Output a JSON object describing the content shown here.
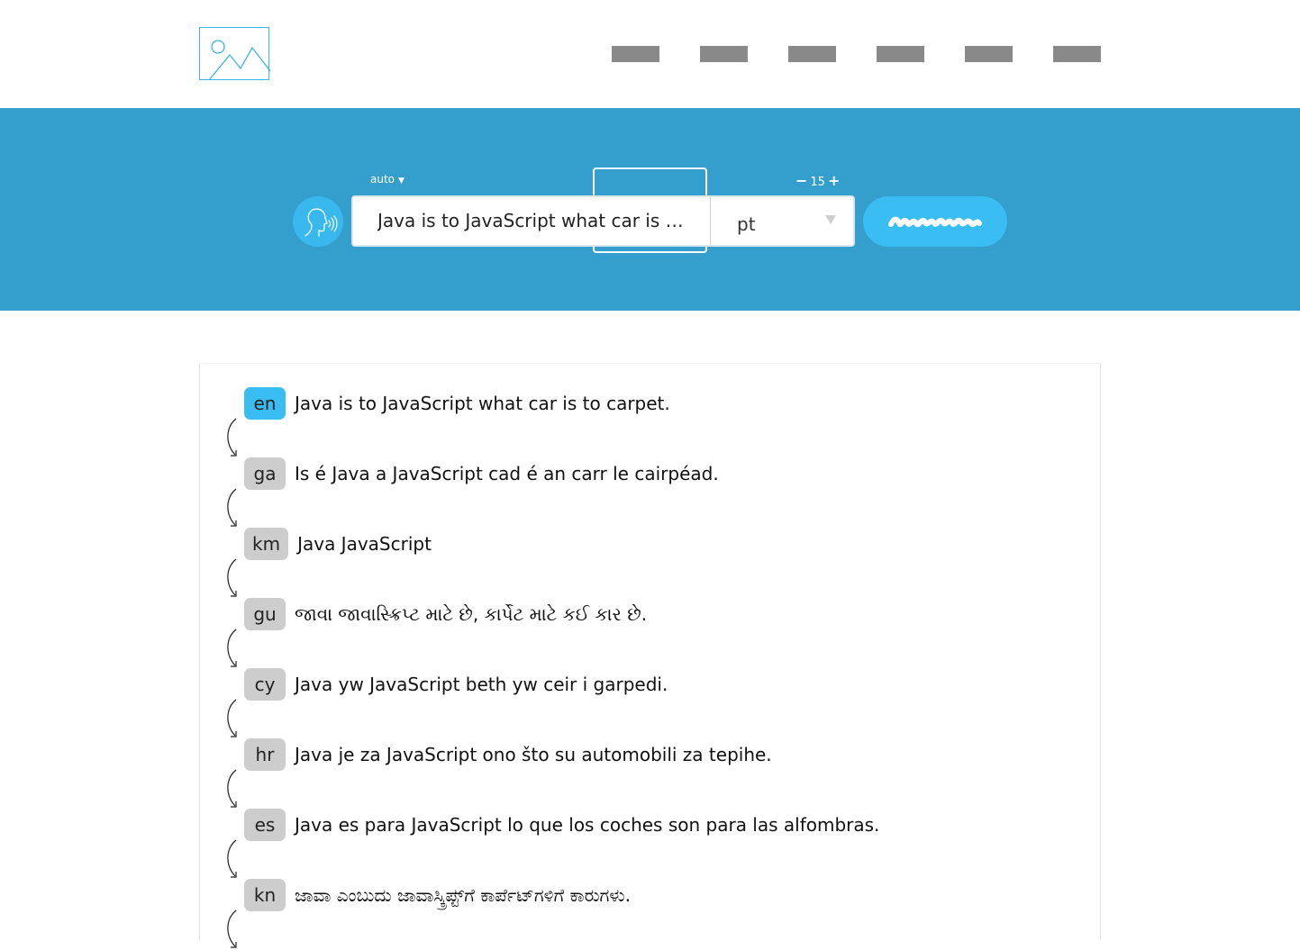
{
  "header": {
    "logo_icon": "image-placeholder-icon",
    "nav_items": [
      "",
      "",
      "",
      "",
      "",
      ""
    ]
  },
  "toolbar": {
    "source_language": "auto",
    "source_caret": "▼",
    "input_value": "Java is to JavaScript what car is t…",
    "target_language": "pt",
    "count": "15",
    "decrement": "−",
    "increment": "+",
    "speak_icon": "speaking-head-icon",
    "translate_label": ""
  },
  "colors": {
    "band": "#349ecd",
    "accent": "#39bdf3",
    "chip": "#cdcdcd"
  },
  "results": [
    {
      "code": "en",
      "text": "Java is to JavaScript what car is to carpet.",
      "active": true
    },
    {
      "code": "ga",
      "text": "Is é Java a JavaScript cad é an carr le cairpéad."
    },
    {
      "code": "km",
      "text": "Java                JavaScript"
    },
    {
      "code": "gu",
      "text": "જાવા જાવાસ્ક્રિપ્ટ માટે છે, કાર્પેટ માટે કઈ કાર છે."
    },
    {
      "code": "cy",
      "text": "Java yw JavaScript beth yw ceir i garpedi."
    },
    {
      "code": "hr",
      "text": "Java je za JavaScript ono što su automobili za tepihe."
    },
    {
      "code": "es",
      "text": "Java es para JavaScript lo que los coches son para las alfombras."
    },
    {
      "code": "kn",
      "text": "ಜಾವಾ ಎಂಬುದು ಜಾವಾಸ್ಕ್ರಿಪ್ಟ್‌ಗೆ ಕಾರ್ಪೆಟ್‌ಗಳಿಗೆ ಕಾರುಗಳು."
    }
  ]
}
